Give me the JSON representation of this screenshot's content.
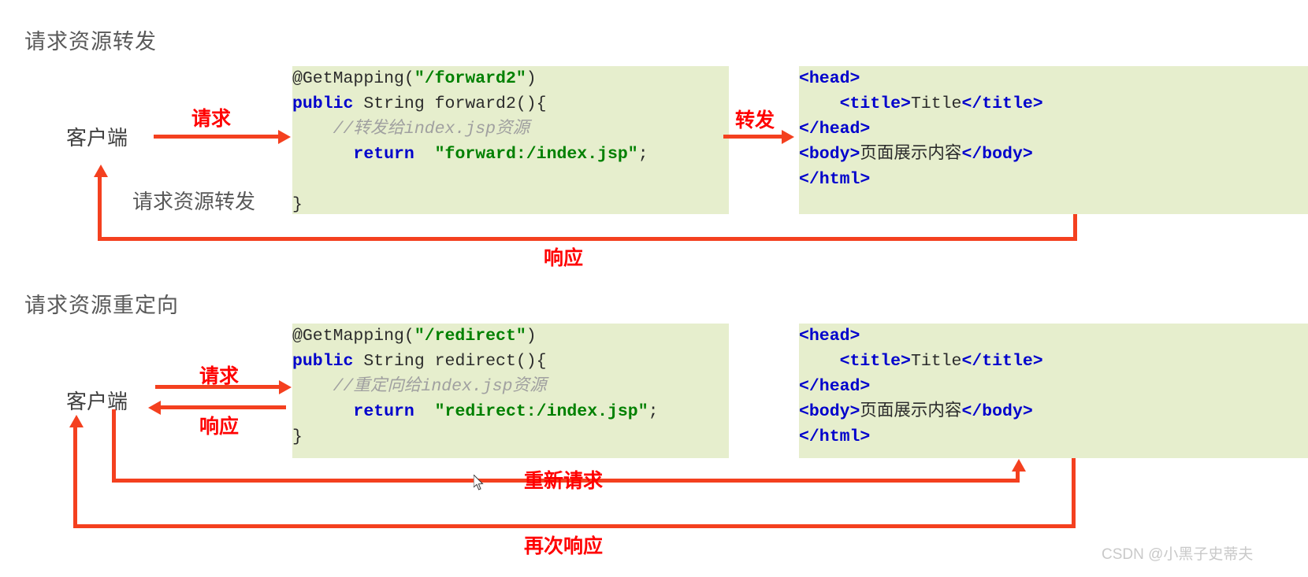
{
  "diagram": {
    "title": "请求资源转发 / 请求资源重定向 流程图",
    "sections": [
      {
        "id": "forward",
        "heading": "请求资源转发",
        "client_label": "客户端",
        "edges": {
          "request": "请求",
          "forward": "转发",
          "return_path": "请求资源转发",
          "response": "响应"
        },
        "code_panel": {
          "lines": [
            "@GetMapping(\"/forward2\")",
            "public String forward2(){",
            "    //转发给index.jsp资源",
            "        return \"forward:/index.jsp\";",
            "}"
          ],
          "annotation": "@GetMapping",
          "mapping_path": "/forward2",
          "method_signature": "public String forward2(){",
          "comment": "//转发给index.jsp资源",
          "return_keyword": "return",
          "return_value": "\"forward:/index.jsp\";",
          "closing_brace": "}"
        },
        "html_panel": {
          "lines": [
            "<head>",
            "    <title>Title</title>",
            "</head>",
            "<body>页面展示内容</body>",
            "</html>"
          ],
          "body_text": "页面展示内容",
          "title_text": "Title"
        }
      },
      {
        "id": "redirect",
        "heading": "请求资源重定向",
        "client_label": "客户端",
        "edges": {
          "request": "请求",
          "response": "响应",
          "re_request": "重新请求",
          "second_response": "再次响应"
        },
        "code_panel": {
          "lines": [
            "@GetMapping(\"/redirect\")",
            "public String redirect(){",
            "    //重定向给index.jsp资源",
            "        return \"redirect:/index.jsp\";",
            "}"
          ],
          "annotation": "@GetMapping",
          "mapping_path": "/redirect",
          "method_signature": "public String redirect(){",
          "comment": "//重定向给index.jsp资源",
          "return_keyword": "return",
          "return_value": "\"redirect:/index.jsp\";",
          "closing_brace": "}"
        },
        "html_panel": {
          "lines": [
            "<head>",
            "    <title>Title</title>",
            "</head>",
            "<body>页面展示内容</body>",
            "</html>"
          ],
          "body_text": "页面展示内容",
          "title_text": "Title"
        }
      }
    ],
    "watermark": "CSDN @小黑子史蒂夫",
    "colors": {
      "panel_background": "#e6eecd",
      "arrow_red": "#f4401f",
      "label_red": "#ff0000",
      "keyword_blue": "#0000cc",
      "string_green": "#008000",
      "comment_gray": "#a0a0a0",
      "heading_gray": "#595959",
      "watermark_gray": "#c9c9c9",
      "page_background": "#ffffff"
    }
  }
}
